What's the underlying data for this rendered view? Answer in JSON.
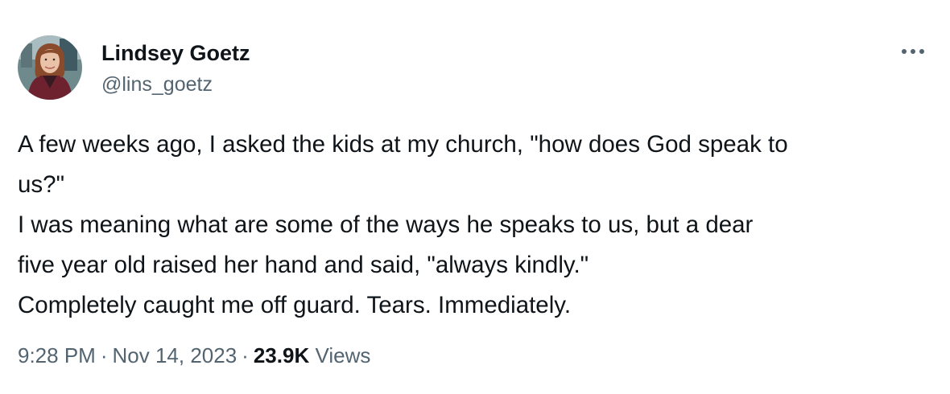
{
  "author": {
    "name": "Lindsey Goetz",
    "handle": "@lins_goetz",
    "avatar_icon": "profile-photo"
  },
  "more_icon": "more-options-icon",
  "tweet": {
    "lines": [
      "A few weeks ago, I asked the kids at my church, \"how does God speak to",
      "us?\"",
      "I was meaning what are some of the ways he speaks to us, but a dear",
      "five year old raised her hand and said, \"always kindly.\"",
      "Completely caught me off guard. Tears. Immediately."
    ]
  },
  "meta": {
    "time": "9:28 PM",
    "separator": "·",
    "date": "Nov 14, 2023",
    "views_count": "23.9K",
    "views_label": "Views"
  },
  "colors": {
    "text": "#0f1419",
    "secondary": "#536471"
  }
}
